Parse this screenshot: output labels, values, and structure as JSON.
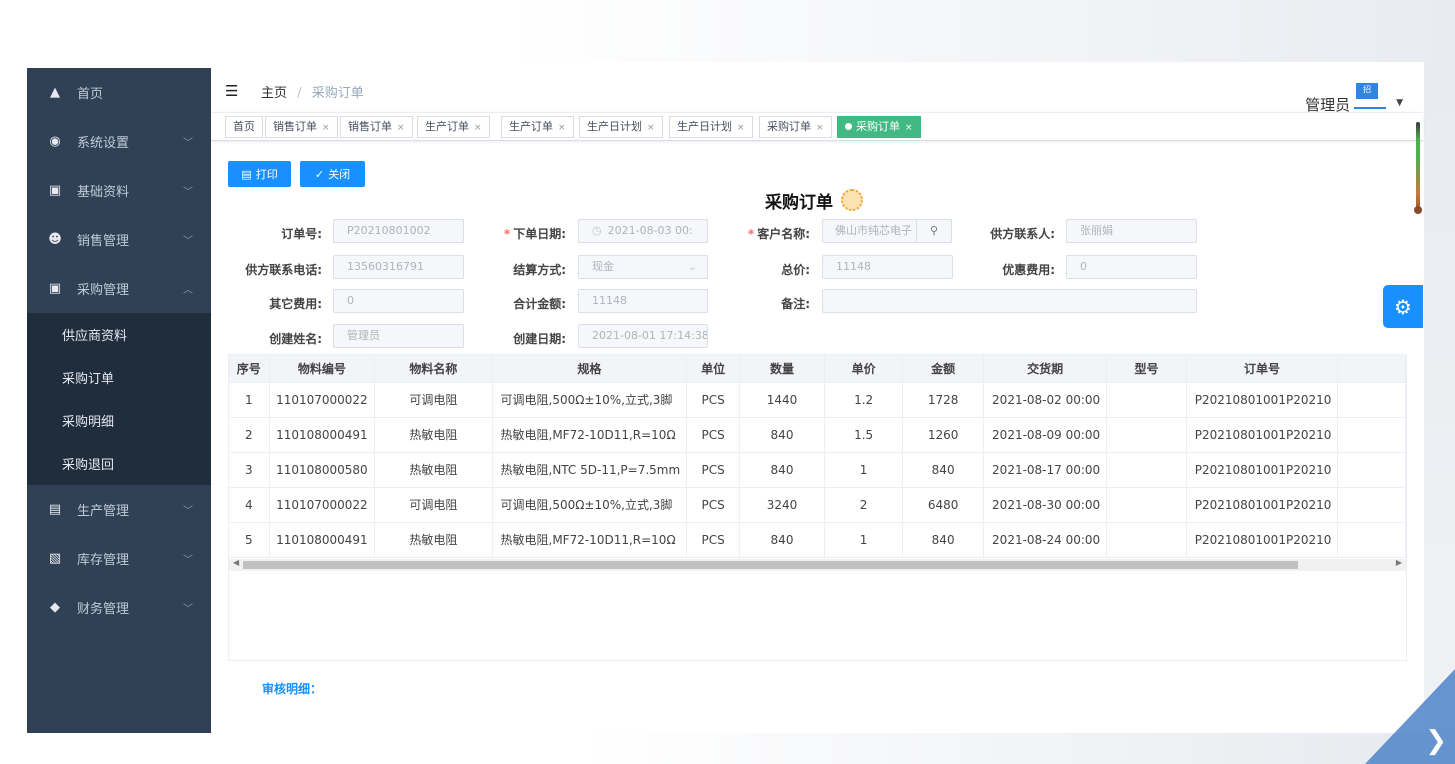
{
  "sidebar": {
    "items": [
      {
        "label": "首页",
        "icon": "home-icon",
        "chevron": false
      },
      {
        "label": "系统设置",
        "icon": "settings-circle-icon",
        "chevron": true
      },
      {
        "label": "基础资料",
        "icon": "truck-icon",
        "chevron": true
      },
      {
        "label": "销售管理",
        "icon": "people-icon",
        "chevron": true
      },
      {
        "label": "采购管理",
        "icon": "truck-icon",
        "chevron": true,
        "expanded": true
      }
    ],
    "submenu": [
      "供应商资料",
      "采购订单",
      "采购明细",
      "采购退回"
    ],
    "items_after": [
      {
        "label": "生产管理",
        "icon": "document-icon"
      },
      {
        "label": "库存管理",
        "icon": "inventory-icon"
      },
      {
        "label": "财务管理",
        "icon": "graduation-icon"
      }
    ],
    "chevron_down": "﹀",
    "chevron_up": "︿"
  },
  "header": {
    "breadcrumb_home": "主页",
    "breadcrumb_sep": "/",
    "breadcrumb_current": "采购订单",
    "user_name": "管理员",
    "flag_text": "招"
  },
  "tags": [
    {
      "label": "首页",
      "closable": false
    },
    {
      "label": "销售订单",
      "closable": true
    },
    {
      "label": "销售订单",
      "closable": true
    },
    {
      "label": "生产订单",
      "closable": true
    },
    {
      "label": "生产订单",
      "closable": true
    },
    {
      "label": "生产日计划",
      "closable": true
    },
    {
      "label": "生产日计划",
      "closable": true
    },
    {
      "label": "采购订单",
      "closable": true
    },
    {
      "label": "采购订单",
      "closable": true,
      "active": true
    }
  ],
  "tag_close": "×",
  "toolbar": {
    "print_label": "打印",
    "close_label": "关闭"
  },
  "page_title": "采购订单",
  "form": {
    "order_no": {
      "label": "订单号:",
      "value": "P20210801002"
    },
    "order_date": {
      "label": "下单日期:",
      "value": "2021-08-03 00:",
      "required": "*"
    },
    "customer": {
      "label": "客户名称:",
      "value": "佛山市纯芯电子",
      "required": "*"
    },
    "supplier_contact": {
      "label": "供方联系人:",
      "value": "张丽娟"
    },
    "supplier_phone": {
      "label": "供方联系电话:",
      "value": "13560316791"
    },
    "settlement": {
      "label": "结算方式:",
      "value": "现金"
    },
    "total": {
      "label": "总价:",
      "value": "11148"
    },
    "discount": {
      "label": "优惠费用:",
      "value": "0"
    },
    "other_fee": {
      "label": "其它费用:",
      "value": "0"
    },
    "sum_amount": {
      "label": "合计金额:",
      "value": "11148"
    },
    "remark": {
      "label": "备注:",
      "value": ""
    },
    "creator": {
      "label": "创建姓名:",
      "value": "管理员"
    },
    "created": {
      "label": "创建日期:",
      "value": "2021-08-01 17:14:38"
    }
  },
  "table": {
    "headers": [
      "序号",
      "物料编号",
      "物料名称",
      "规格",
      "单位",
      "数量",
      "单价",
      "金额",
      "交货期",
      "型号",
      "订单号",
      ""
    ],
    "rows": [
      [
        "1",
        "110107000022",
        "可调电阻",
        "可调电阻,500Ω±10%,立式,3脚",
        "PCS",
        "1440",
        "1.2",
        "1728",
        "2021-08-02 00:00",
        "",
        "P20210801001P20210"
      ],
      [
        "2",
        "110108000491",
        "热敏电阻",
        "热敏电阻,MF72-10D11,R=10Ω",
        "PCS",
        "840",
        "1.5",
        "1260",
        "2021-08-09 00:00",
        "",
        "P20210801001P20210"
      ],
      [
        "3",
        "110108000580",
        "热敏电阻",
        "热敏电阻,NTC 5D-11,P=7.5mm",
        "PCS",
        "840",
        "1",
        "840",
        "2021-08-17 00:00",
        "",
        "P20210801001P20210"
      ],
      [
        "4",
        "110107000022",
        "可调电阻",
        "可调电阻,500Ω±10%,立式,3脚",
        "PCS",
        "3240",
        "2",
        "6480",
        "2021-08-30 00:00",
        "",
        "P20210801001P20210"
      ],
      [
        "5",
        "110108000491",
        "热敏电阻",
        "热敏电阻,MF72-10D11,R=10Ω",
        "PCS",
        "840",
        "1",
        "840",
        "2021-08-24 00:00",
        "",
        "P20210801001P20210"
      ]
    ]
  },
  "audit_label": "审核明细：",
  "colors": {
    "sidebar_bg": "#304156",
    "primary": "#1890ff",
    "active_tag": "#42b983"
  }
}
